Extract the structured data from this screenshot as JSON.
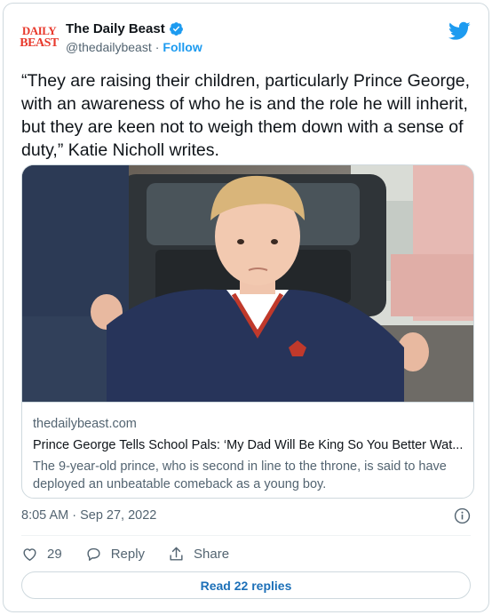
{
  "account": {
    "logo_line1": "DAILY",
    "logo_line2": "BEAST",
    "name": "The Daily Beast",
    "handle": "@thedailybeast",
    "separator": "·",
    "follow_label": "Follow"
  },
  "tweet": {
    "text": "“They are raising their children, particularly Prince George, with an awareness of who he is and the role he will inherit, but they are keen not to weigh them down with a sense of duty,” Katie Nicholl writes."
  },
  "link_card": {
    "domain": "thedailybeast.com",
    "title": "Prince George Tells School Pals: ‘My Dad Will Be King So You Better Wat...",
    "description": "The 9-year-old prince, who is second in line to the throne, is said to have deployed an unbeatable comeback as a young boy."
  },
  "timestamp": "8:05 AM · Sep 27, 2022",
  "actions": {
    "like_count": "29",
    "reply_label": "Reply",
    "share_label": "Share"
  },
  "read_replies_label": "Read 22 replies",
  "colors": {
    "accent": "#1d9bf0",
    "brand_red": "#e8392c"
  }
}
